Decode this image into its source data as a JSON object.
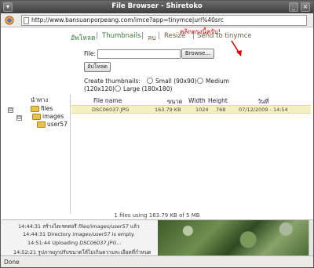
{
  "window": {
    "title": "File Browser - Shiretoko"
  },
  "address": {
    "url": "http://www.bansuanporpeang.com/imce?app=tinymce|url%40src"
  },
  "tabs": {
    "upload": "อัพโหลด",
    "thumbnails": "Thumbnails",
    "delete": "ลบ",
    "resize": "Resize",
    "send": "Send to tinymce"
  },
  "annotation": "คลิกตรงนี้ครับ!",
  "upload_form": {
    "file_label": "File:",
    "browse_button": "Browse...",
    "upload_button": "อัปโหลด",
    "create_thumbs_label": "Create thumbnails:",
    "opt_small": "Small (90x90)",
    "opt_medium": "Medium",
    "opt_medium_size": "(120x120)",
    "opt_large": "Large (180x180)"
  },
  "tree": {
    "header": "นำทาง",
    "nodes": [
      "files",
      "images",
      "user57"
    ],
    "expanders": [
      "⊟",
      "⊟"
    ]
  },
  "file_table": {
    "headers": [
      "File name",
      "ขนาด",
      "Width",
      "Height",
      "วันที่"
    ],
    "rows": [
      {
        "name": "DSC06037.JPG",
        "size": "163.79 KB",
        "width": "1024",
        "height": "768",
        "date": "07/12/2009 - 14:54"
      }
    ],
    "summary": "1 files using 163.79 KB of 5 MB"
  },
  "log": [
    {
      "time": "14:44:31",
      "text_a": "สร้างไดเรคทอรี ",
      "path": "files/images/user57",
      "text_b": " แล้ว"
    },
    {
      "time": "14:44:31",
      "text_a": "Directory ",
      "path": "images/user57",
      "text_b": " is empty."
    },
    {
      "time": "14:51:44",
      "text_a": "Uploading ",
      "path": "DSC06037.JPG",
      "text_b": "..."
    },
    {
      "time": "14:52:21",
      "text_a": "รูปภาพถูกปรับขนาดให้ไม่เกินความละเอียดที่กำหนด",
      "path": "",
      "text_b": ""
    }
  ],
  "statusbar": {
    "text": "Done"
  }
}
